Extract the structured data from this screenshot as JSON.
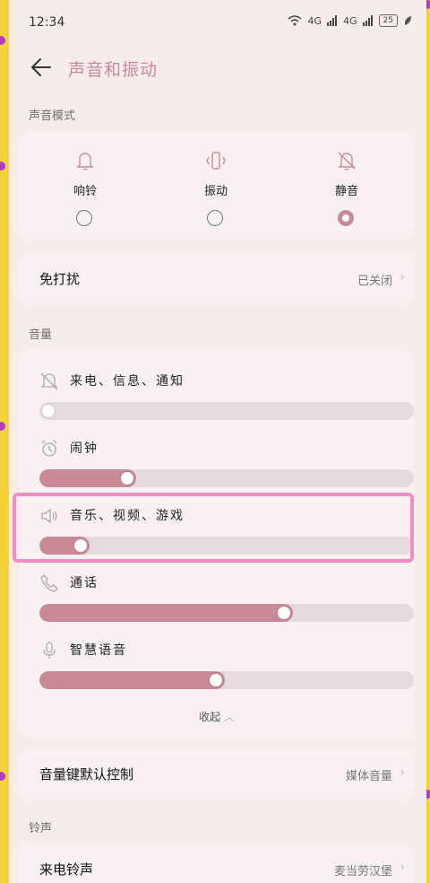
{
  "status": {
    "time": "12:34",
    "net1": "4G",
    "net2": "4G",
    "battery": "25"
  },
  "header": {
    "title": "声音和振动"
  },
  "sound_mode": {
    "label": "声音模式",
    "modes": [
      {
        "label": "响铃",
        "icon": "bell-icon",
        "selected": false
      },
      {
        "label": "振动",
        "icon": "vibrate-icon",
        "selected": false
      },
      {
        "label": "静音",
        "icon": "bell-off-icon",
        "selected": true
      }
    ]
  },
  "dnd": {
    "label": "免打扰",
    "value": "已关闭"
  },
  "volume": {
    "label": "音量",
    "items": [
      {
        "label": "来电、信息、通知",
        "icon": "bell-off-icon",
        "level": 0.0
      },
      {
        "label": "闹钟",
        "icon": "alarm-clock-icon",
        "level": 0.22
      },
      {
        "label": "音乐、视频、游戏",
        "icon": "speaker-icon",
        "level": 0.09
      },
      {
        "label": "通话",
        "icon": "phone-icon",
        "level": 0.66
      },
      {
        "label": "智慧语音",
        "icon": "microphone-icon",
        "level": 0.47
      }
    ],
    "collapse_label": "收起"
  },
  "volume_key": {
    "label": "音量键默认控制",
    "value": "媒体音量"
  },
  "ringtone": {
    "label": "铃声",
    "incoming_label": "来电铃声",
    "incoming_value": "麦当劳汉堡"
  },
  "colors": {
    "accent": "#c98a98",
    "highlight": "#ee8fc4",
    "frame": "#f2d33a"
  }
}
